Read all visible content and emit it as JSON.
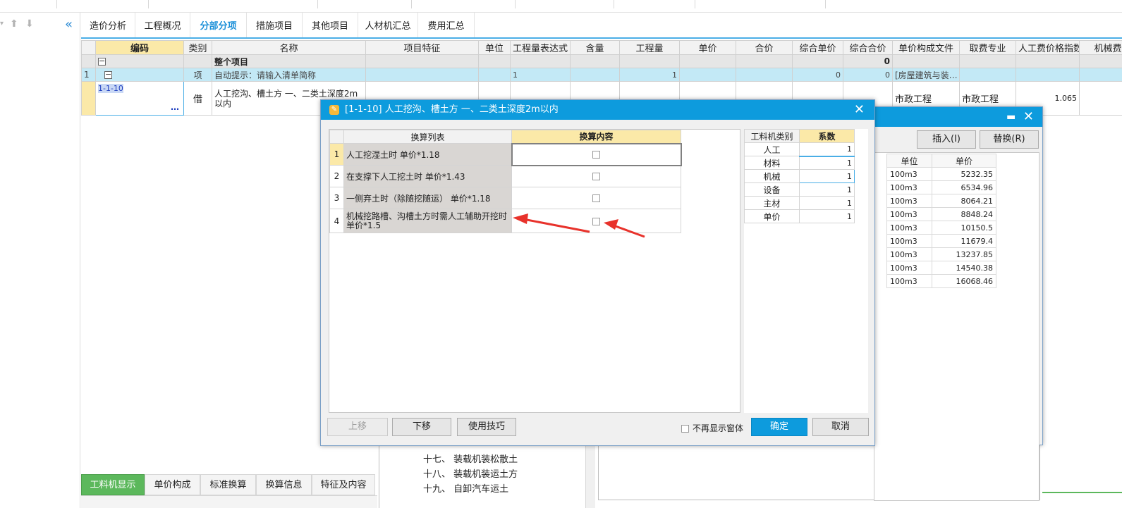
{
  "tabs": [
    "造价分析",
    "工程概况",
    "分部分项",
    "措施项目",
    "其他项目",
    "人材机汇总",
    "费用汇总"
  ],
  "active_tab": "分部分项",
  "grid": {
    "columns": [
      "编码",
      "类别",
      "名称",
      "项目特征",
      "单位",
      "工程量表达式",
      "含量",
      "工程量",
      "单价",
      "合价",
      "综合单价",
      "综合合价",
      "单价构成文件",
      "取费专业",
      "人工费价格指数",
      "机械费"
    ],
    "total_row": {
      "name": "整个项目",
      "total": "0"
    },
    "item_row": {
      "no": "1",
      "type": "项",
      "name": "自动提示：请输入清单简称",
      "expr": "1",
      "qty": "1",
      "unit_price": "0",
      "total": "0",
      "file": "[房屋建筑与装…"
    },
    "sub_row": {
      "code": "1-1-10",
      "ellipsis": "…",
      "type": "借",
      "name": "人工挖沟、槽土方 一、二类土深度2m以内",
      "file": "市政工程",
      "spec": "市政工程",
      "index": "1.065"
    }
  },
  "bottom_tabs": [
    "工料机显示",
    "单价构成",
    "标准换算",
    "换算信息",
    "特征及内容"
  ],
  "tree_items": [
    "十七、 装载机装松散土",
    "十八、 装载机装运土方",
    "十九、 自卸汽车运土"
  ],
  "dialog_back": {
    "insert_label": "插入(I)",
    "replace_label": "替换(R)",
    "col_unit": "单位",
    "col_price": "单价",
    "rows": [
      {
        "unit": "100m3",
        "price": "5232.35"
      },
      {
        "unit": "100m3",
        "price": "6534.96"
      },
      {
        "unit": "100m3",
        "price": "8064.21"
      },
      {
        "unit": "100m3",
        "price": "8848.24"
      },
      {
        "unit": "100m3",
        "price": "10150.5"
      },
      {
        "unit": "100m3",
        "price": "11679.4"
      },
      {
        "unit": "100m3",
        "price": "13237.85"
      },
      {
        "unit": "100m3",
        "price": "14540.38"
      },
      {
        "unit": "100m3",
        "price": "16068.46"
      }
    ]
  },
  "dialog": {
    "title": "[1-1-10] 人工挖沟、槽土方 一、二类土深度2m以内",
    "col_list": "换算列表",
    "col_content": "换算内容",
    "rows": [
      {
        "no": "1",
        "label": "人工挖湿土时 单价*1.18"
      },
      {
        "no": "2",
        "label": "在支撑下人工挖土时 单价*1.43"
      },
      {
        "no": "3",
        "label": "一侧弃土时（除随挖随运） 单价*1.18"
      },
      {
        "no": "4",
        "label": "机械挖路槽、沟槽土方时需人工辅助开挖时单价*1.5"
      }
    ],
    "coef_header": [
      "工料机类别",
      "系数"
    ],
    "coef_rows": [
      {
        "cat": "人工",
        "val": "1"
      },
      {
        "cat": "材料",
        "val": "1"
      },
      {
        "cat": "机械",
        "val": "1"
      },
      {
        "cat": "设备",
        "val": "1"
      },
      {
        "cat": "主材",
        "val": "1"
      },
      {
        "cat": "单价",
        "val": "1"
      }
    ],
    "btn_up": "上移",
    "btn_down": "下移",
    "btn_tips": "使用技巧",
    "no_show": "不再显示窗体",
    "btn_ok": "确定",
    "btn_cancel": "取消"
  },
  "colors": {
    "accent": "#0d9bdd",
    "annotation": "#e8322b",
    "active_bottom_tab": "#5cb85c"
  }
}
